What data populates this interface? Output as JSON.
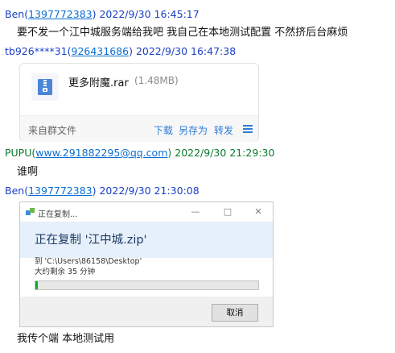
{
  "messages": [
    {
      "sender_name": "Ben",
      "sender_id": "1397772383",
      "timestamp": "2022/9/30 16:45:17",
      "text": "要不发一个江中城服务端给我吧 我自己在本地测试配置 不然挤后台麻烦"
    },
    {
      "sender_name": "tb926****31",
      "sender_id": "926431686",
      "timestamp": "2022/9/30 16:47:38",
      "file": {
        "name": "更多附魔.rar",
        "size": "(1.48MB)",
        "source": "来自群文件",
        "actions": [
          "下载",
          "另存为",
          "转发"
        ],
        "menu_icon": "hamburger-menu-icon"
      }
    },
    {
      "sender_name": "PUPU",
      "sender_id": "www.291882295@qq.com",
      "timestamp": "2022/9/30 21:29:30",
      "text": "谁啊"
    },
    {
      "sender_name": "Ben",
      "sender_id": "1397772383",
      "timestamp": "2022/9/30 21:30:08",
      "image": {
        "title": "正在复制...",
        "heading": "正在复制 '江中城.zip'",
        "destination": "到 'C:\\Users\\86158\\Desktop'",
        "remaining": "大约剩余 35 分钟",
        "progress": 0.01,
        "cancel_label": "取消",
        "window_buttons": [
          "—",
          "□",
          "✕"
        ]
      }
    },
    {
      "text": "我传个端 本地测试用"
    }
  ],
  "colors": {
    "sender_blue": "#1a3fc7",
    "sender_green": "#0a7a2e",
    "link": "#0b6fd1",
    "action": "#2f7bd6",
    "progress": "#06b025"
  },
  "icons": {
    "file": "archive-file-icon",
    "copy": "copy-files-icon"
  }
}
